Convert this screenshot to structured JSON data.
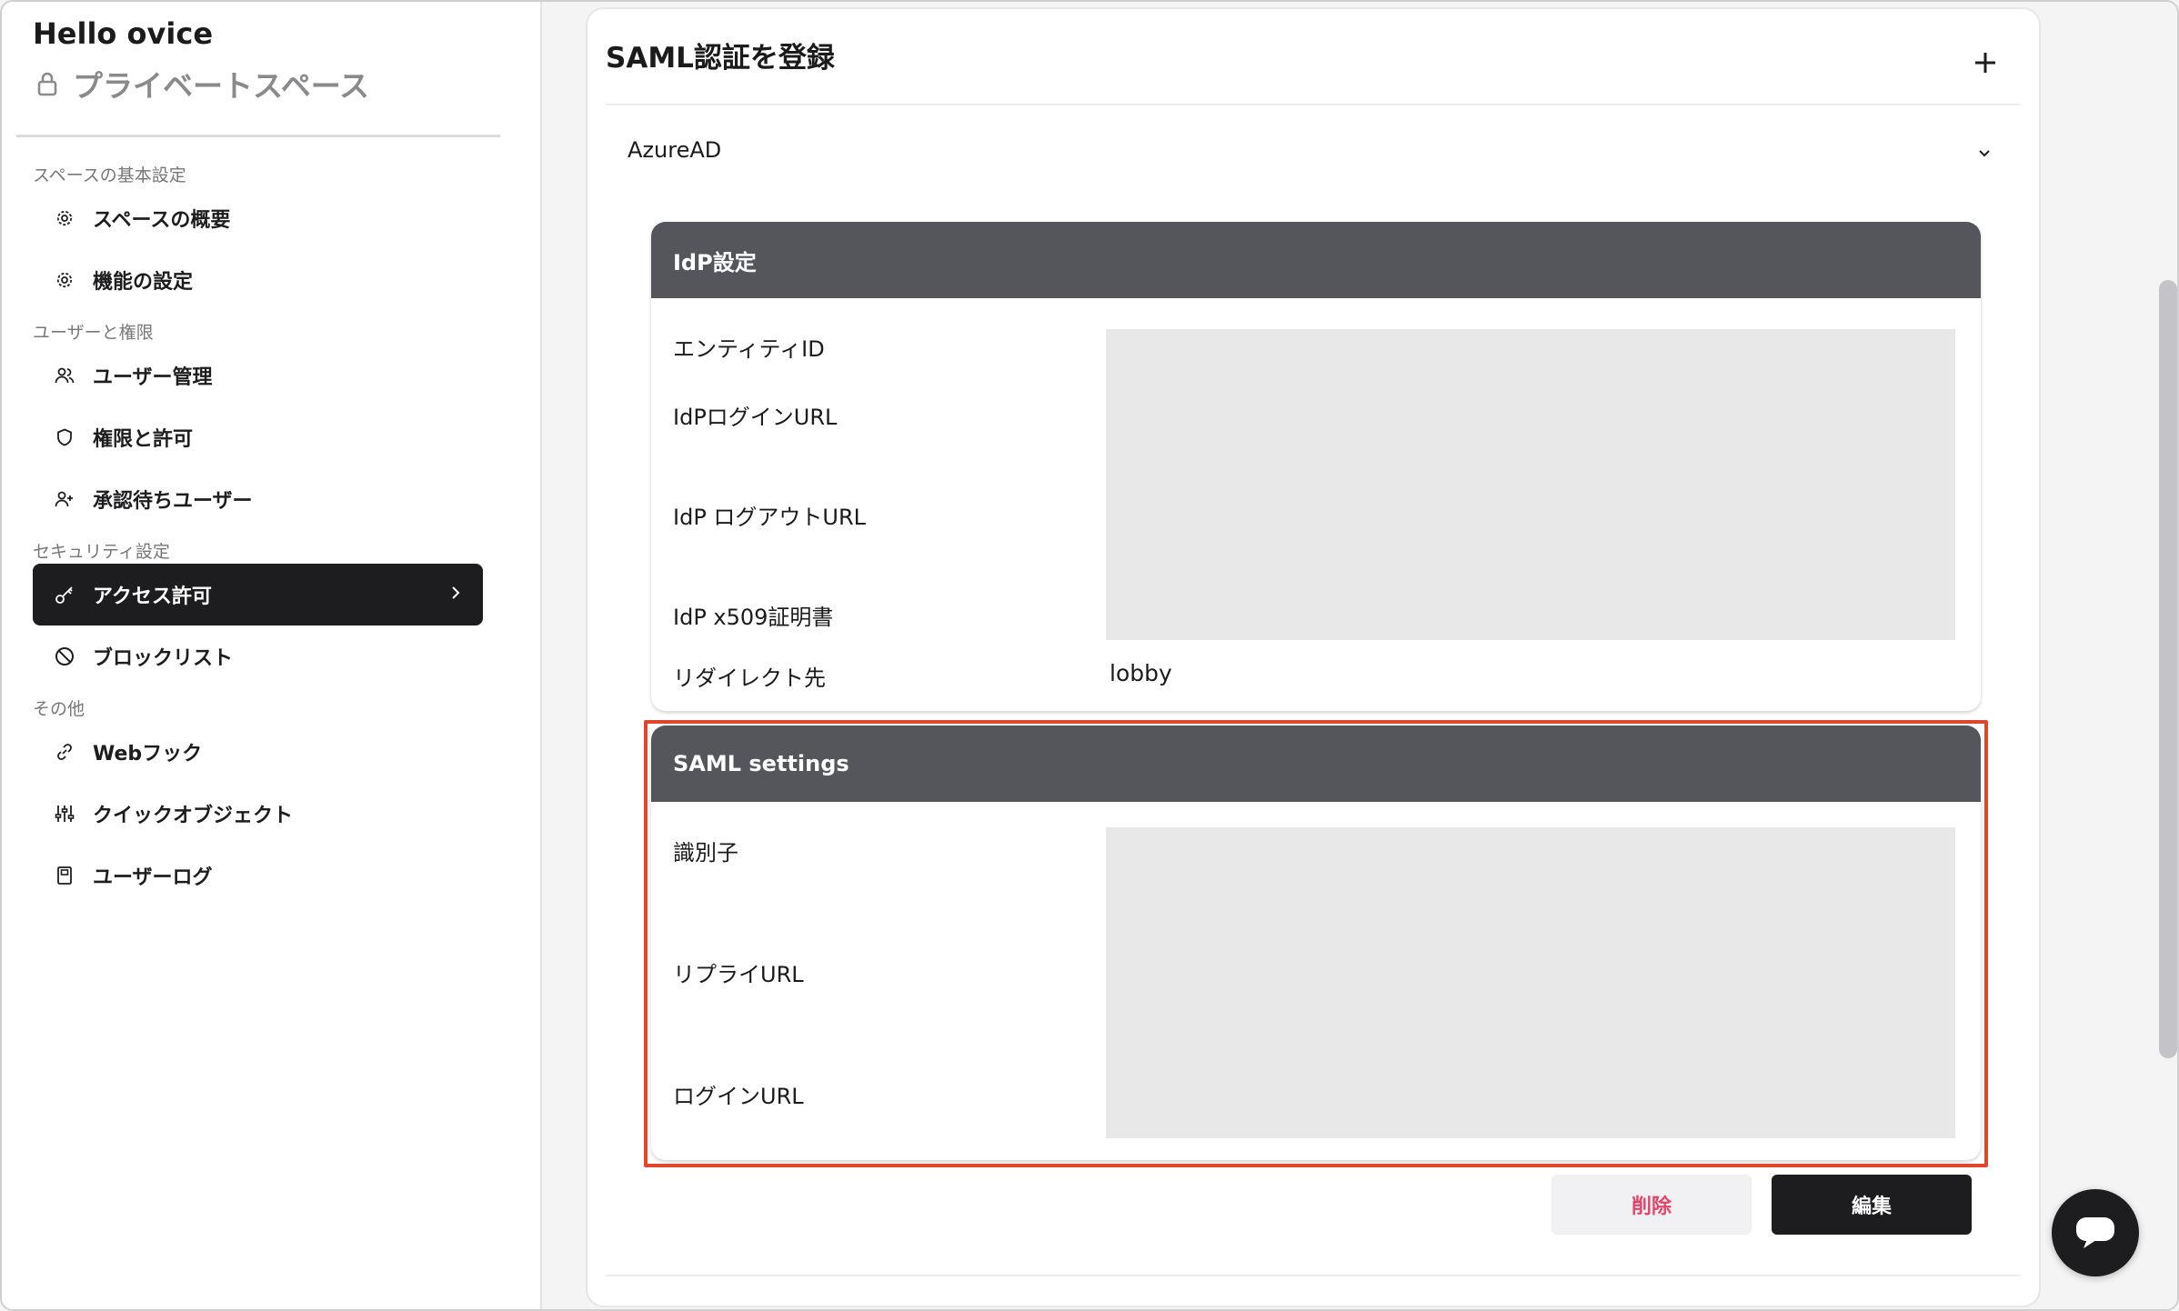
{
  "sidebar": {
    "space_name": "Hello ovice",
    "space_type": "プライベートスペース",
    "sections": {
      "basic": "スペースの基本設定",
      "users": "ユーザーと権限",
      "security": "セキュリティ設定",
      "other": "その他"
    },
    "items": {
      "overview": "スペースの概要",
      "features": "機能の設定",
      "user_management": "ユーザー管理",
      "permissions": "権限と許可",
      "pending_users": "承認待ちユーザー",
      "access": "アクセス許可",
      "blocklist": "ブロックリスト",
      "webhook": "Webフック",
      "quick_objects": "クイックオブジェクト",
      "user_log": "ユーザーログ"
    }
  },
  "main": {
    "title": "SAML認証を登録",
    "accordion_label": "AzureAD",
    "idp_panel": {
      "header": "IdP設定",
      "entity_id_label": "エンティティID",
      "login_url_label": "IdPログインURL",
      "logout_url_label": "IdP ログアウトURL",
      "cert_label": "IdP x509証明書",
      "redirect_label": "リダイレクト先",
      "redirect_value": "lobby"
    },
    "saml_panel": {
      "header": "SAML settings",
      "identifier_label": "識別子",
      "reply_url_label": "リプライURL",
      "login_url_label": "ログインURL"
    },
    "delete_label": "削除",
    "edit_label": "編集"
  },
  "colors": {
    "accent_dark": "#1d1d1f",
    "panel_header": "#54565b",
    "highlight": "#e0452e",
    "danger": "#e0456b"
  }
}
